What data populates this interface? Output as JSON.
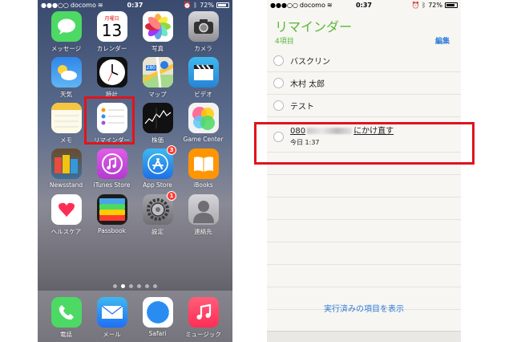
{
  "home": {
    "status": {
      "carrier": "docomo",
      "time": "0:37",
      "battery": "72%"
    },
    "apps": [
      {
        "label": "メッセージ",
        "icon": "messages-icon",
        "color": "#4cd964"
      },
      {
        "label": "カレンダー",
        "icon": "calendar-icon",
        "color": "#ffffff",
        "day_name": "月曜日",
        "day": "13"
      },
      {
        "label": "写真",
        "icon": "photos-icon",
        "color": "#ffffff"
      },
      {
        "label": "カメラ",
        "icon": "camera-icon",
        "color": "#8e8e93"
      },
      {
        "label": "天気",
        "icon": "weather-icon",
        "color": "#3a9cf0"
      },
      {
        "label": "時計",
        "icon": "clock-icon",
        "color": "#111111"
      },
      {
        "label": "マップ",
        "icon": "maps-icon",
        "color": "#e8e2cf",
        "badge_text": "280"
      },
      {
        "label": "ビデオ",
        "icon": "videos-icon",
        "color": "#34aadc"
      },
      {
        "label": "メモ",
        "icon": "notes-icon",
        "color": "#fdfae8"
      },
      {
        "label": "リマインダー",
        "icon": "reminders-icon",
        "color": "#ffffff"
      },
      {
        "label": "株価",
        "icon": "stocks-icon",
        "color": "#111111"
      },
      {
        "label": "Game Center",
        "icon": "game-center-icon",
        "color": "#f2f2f2"
      },
      {
        "label": "Newsstand",
        "icon": "newsstand-icon",
        "color": "#3b6f9a"
      },
      {
        "label": "iTunes Store",
        "icon": "itunes-store-icon",
        "color": "#d14cd8"
      },
      {
        "label": "App Store",
        "icon": "app-store-icon",
        "color": "#2a91f0",
        "badge": "3"
      },
      {
        "label": "iBooks",
        "icon": "ibooks-icon",
        "color": "#ff9500"
      },
      {
        "label": "ヘルスケア",
        "icon": "health-icon",
        "color": "#ffffff"
      },
      {
        "label": "Passbook",
        "icon": "passbook-icon",
        "color": "#1c1c1c"
      },
      {
        "label": "設定",
        "icon": "settings-icon",
        "color": "#8e8e93",
        "badge": "1"
      },
      {
        "label": "連絡先",
        "icon": "contacts-icon",
        "color": "#c7c7cc"
      }
    ],
    "dock": [
      {
        "label": "電話",
        "icon": "phone-icon",
        "color": "#4cd964"
      },
      {
        "label": "メール",
        "icon": "mail-icon",
        "color": "#1e8ef5"
      },
      {
        "label": "Safari",
        "icon": "safari-icon",
        "color": "#ffffff"
      },
      {
        "label": "ミュージック",
        "icon": "music-icon",
        "color": "#ff2d55"
      }
    ]
  },
  "reminders": {
    "status": {
      "carrier": "docomo",
      "time": "0:37",
      "battery": "72%"
    },
    "title": "リマインダー",
    "count": "4項目",
    "edit": "編集",
    "items": [
      {
        "text": "バスクリン"
      },
      {
        "text": "木村 太郎"
      },
      {
        "text": "テスト"
      },
      {
        "text_prefix": "080",
        "text_suffix": "にかけ直す",
        "due": "今日 1:37"
      }
    ],
    "show_completed": "実行済みの項目を表示"
  },
  "colors": {
    "highlight": "#e0141e",
    "reminders_green": "#58b838",
    "link_blue": "#2d7bd8"
  }
}
